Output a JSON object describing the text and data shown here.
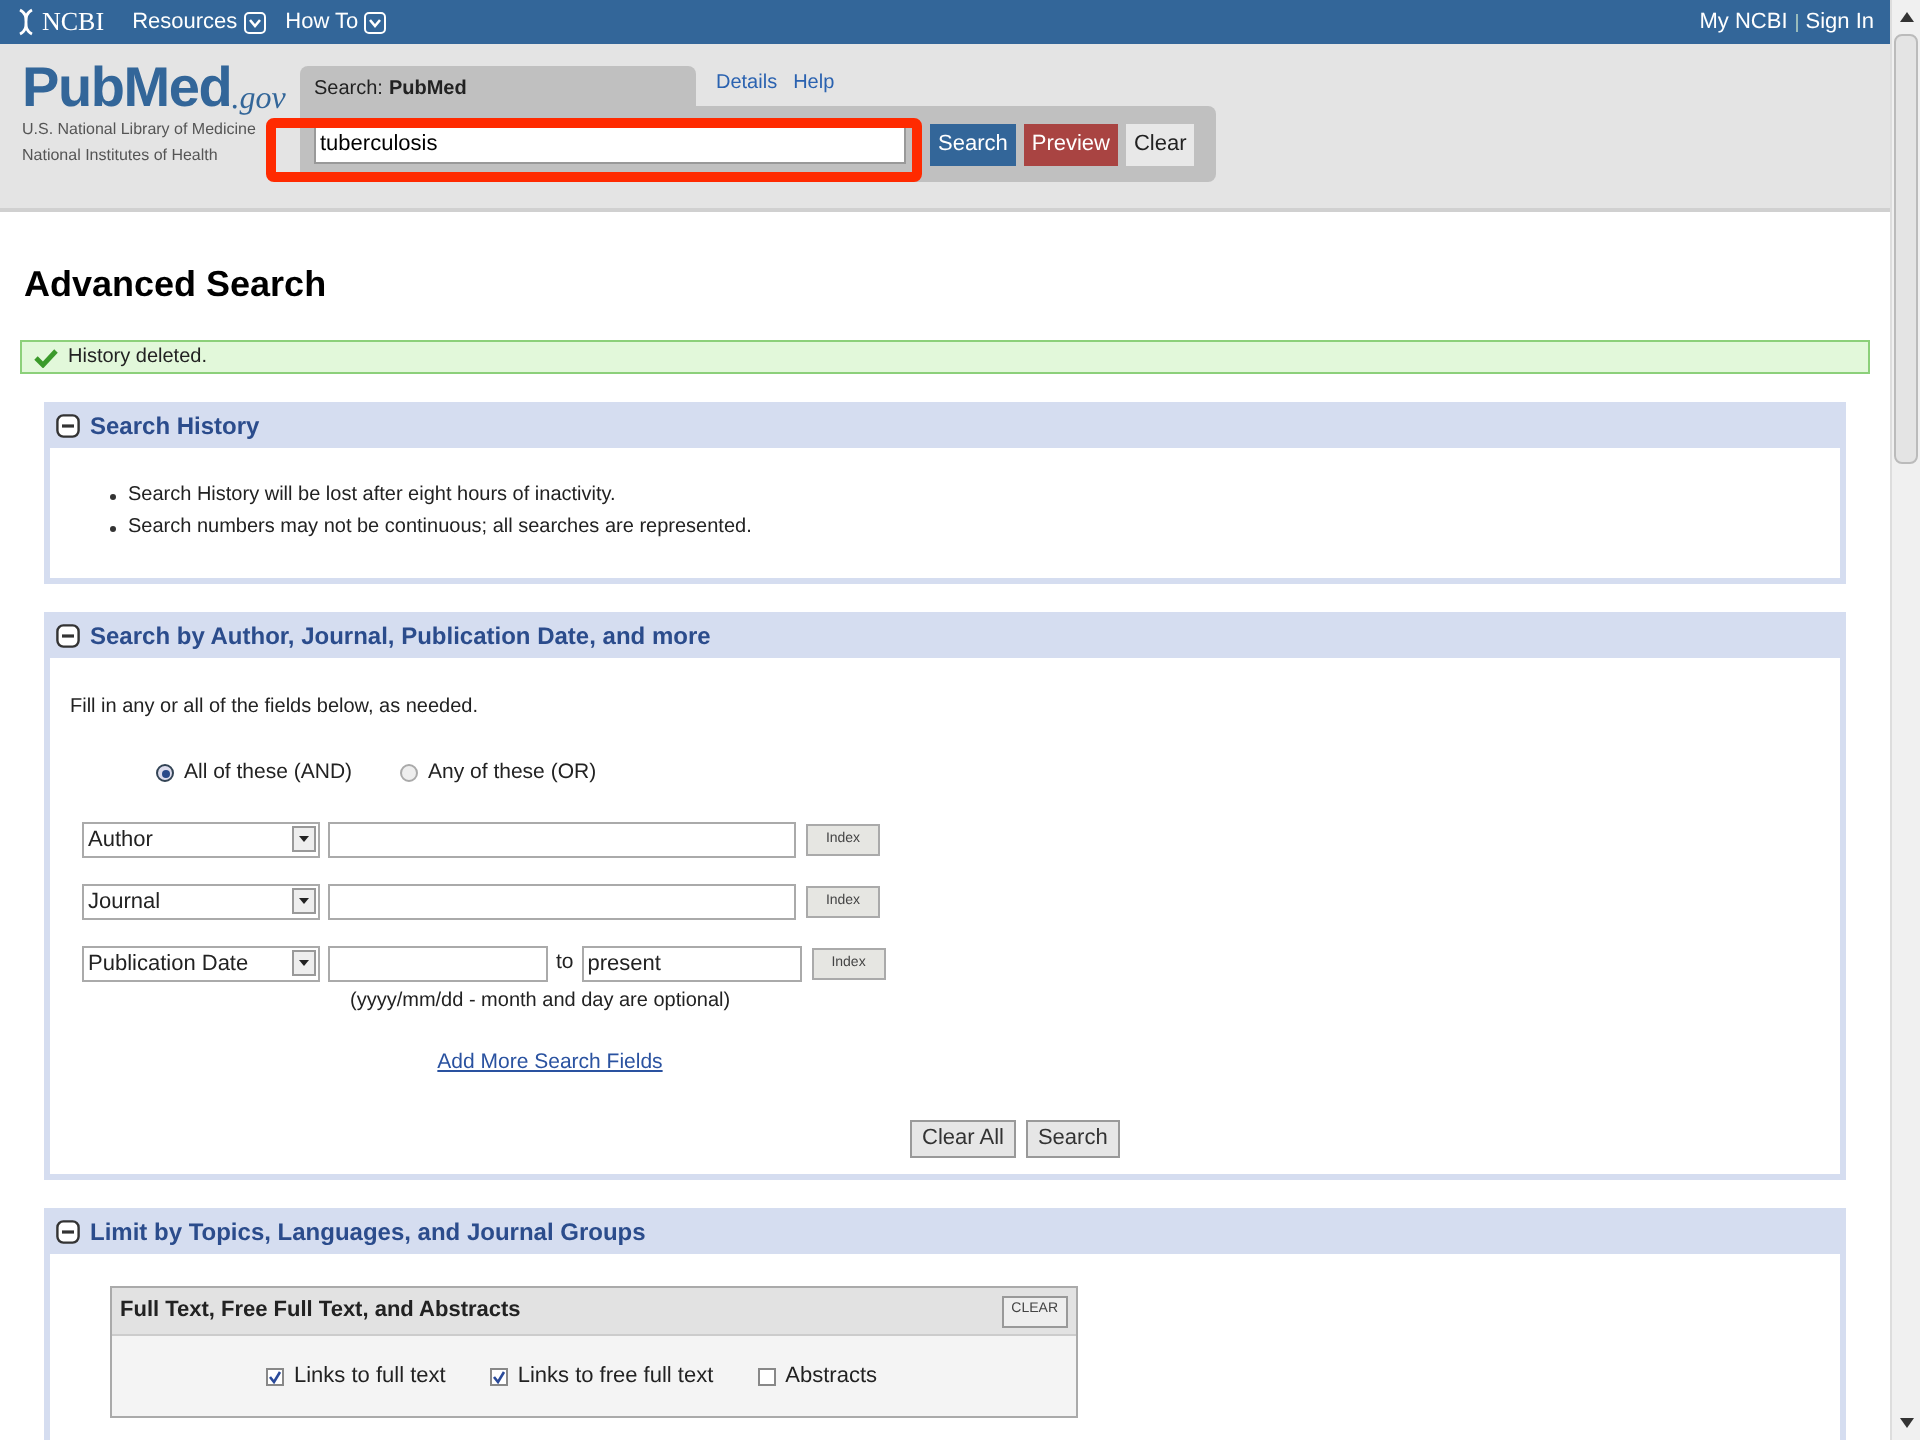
{
  "top_bar": {
    "brand": "NCBI",
    "menus": [
      "Resources",
      "How To"
    ],
    "account": [
      "My NCBI",
      "Sign In"
    ]
  },
  "header": {
    "logo": {
      "main": "PubMed",
      "suffix": ".gov"
    },
    "org_lines": [
      "U.S. National Library of Medicine",
      "National Institutes of Health"
    ],
    "search": {
      "label": "Search:",
      "database": "PubMed",
      "value": "tuberculosis",
      "links": [
        "Details",
        "Help"
      ],
      "highlighted": true,
      "buttons": [
        {
          "label": "Search",
          "kind": "primary"
        },
        {
          "label": "Preview",
          "kind": "preview"
        },
        {
          "label": "Clear",
          "kind": "plain"
        }
      ]
    }
  },
  "page_title": "Advanced Search",
  "message": "History deleted.",
  "sections": [
    {
      "title": "Search History",
      "expanded": true,
      "kind": "notes",
      "notes": [
        "Search History will be lost after eight hours of inactivity.",
        "Search numbers may not be continuous; all searches are represented."
      ]
    },
    {
      "title": "Search by Author, Journal, Publication Date, and more",
      "expanded": true,
      "kind": "builder",
      "intro": "Fill in any or all of the fields below, as needed.",
      "options": [
        {
          "label": "All of these (AND)",
          "selected": true
        },
        {
          "label": "Any of these (OR)",
          "selected": false
        }
      ],
      "rows": [
        {
          "field": "Author",
          "kind": "text",
          "index": "Index"
        },
        {
          "field": "Journal",
          "kind": "text",
          "index": "Index"
        },
        {
          "field": "Publication Date",
          "kind": "range",
          "to": "to",
          "end_value": "present",
          "hint": "(yyyy/mm/dd - month and day are optional)",
          "index": "Index"
        }
      ],
      "add_link": "Add More Search Fields",
      "buttons": [
        "Clear All",
        "Search"
      ]
    },
    {
      "title": "Limit by Topics, Languages, and Journal Groups",
      "expanded": true,
      "kind": "limits",
      "group": {
        "title": "Full Text, Free Full Text, and Abstracts",
        "clear": "CLEAR",
        "checks": [
          {
            "label": "Links to full text",
            "checked": true
          },
          {
            "label": "Links to free full text",
            "checked": true
          },
          {
            "label": "Abstracts",
            "checked": false
          }
        ]
      }
    }
  ]
}
